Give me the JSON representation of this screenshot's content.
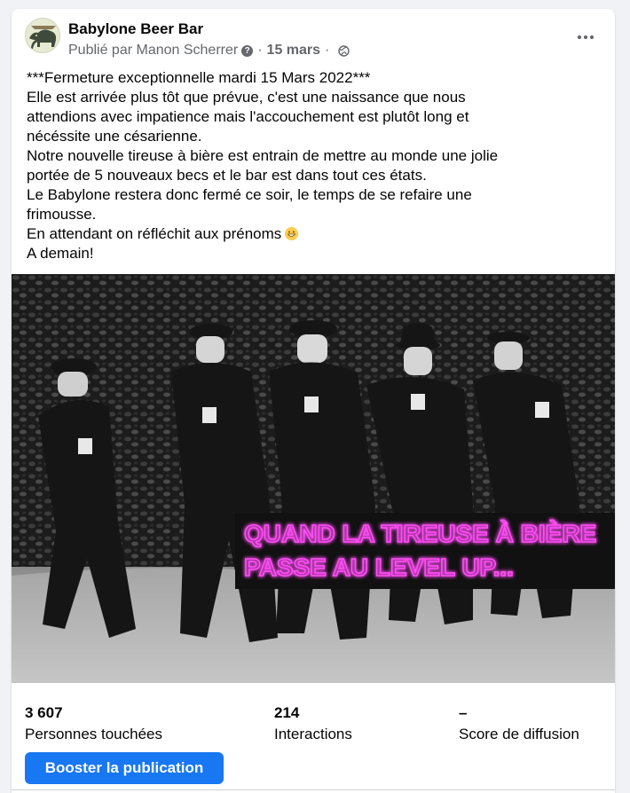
{
  "post": {
    "page_name": "Babylone Beer Bar",
    "published_by": "Publié par Manon Scherrer",
    "date": "15 mars",
    "separator": "·",
    "body_lines": [
      "***Fermeture exceptionnelle mardi 15 Mars 2022***",
      "Elle est arrivée plus tôt que prévue, c'est une naissance que nous",
      "attendions avec impatience mais l'accouchement est plutôt long et",
      "nécéssite une césarienne.",
      "Notre nouvelle tireuse à bière est entrain de mettre au monde une jolie",
      "portée de 5 nouveaux becs et le bar est dans tout ces états.",
      "Le Babylone restera donc fermé ce soir, le temps de se refaire une",
      "frimousse.",
      "En attendant on réfléchit aux prénoms",
      "A demain!"
    ],
    "emoji_icon": "grinning-face-icon",
    "image": {
      "caption_line1": "QUAND LA TIREUSE À BIÈRE",
      "caption_line2": "PASSE AU LEVEL UP...",
      "caption_color": "#ff4df5"
    }
  },
  "stats": {
    "reach_value": "3 607",
    "reach_label": "Personnes touchées",
    "interactions_value": "214",
    "interactions_label": "Interactions",
    "score_value": "–",
    "score_label": "Score de diffusion"
  },
  "actions": {
    "boost_label": "Booster la publication"
  },
  "colors": {
    "accent": "#1877f2",
    "secondary_text": "#65676b",
    "background": "#f0f2f5"
  }
}
